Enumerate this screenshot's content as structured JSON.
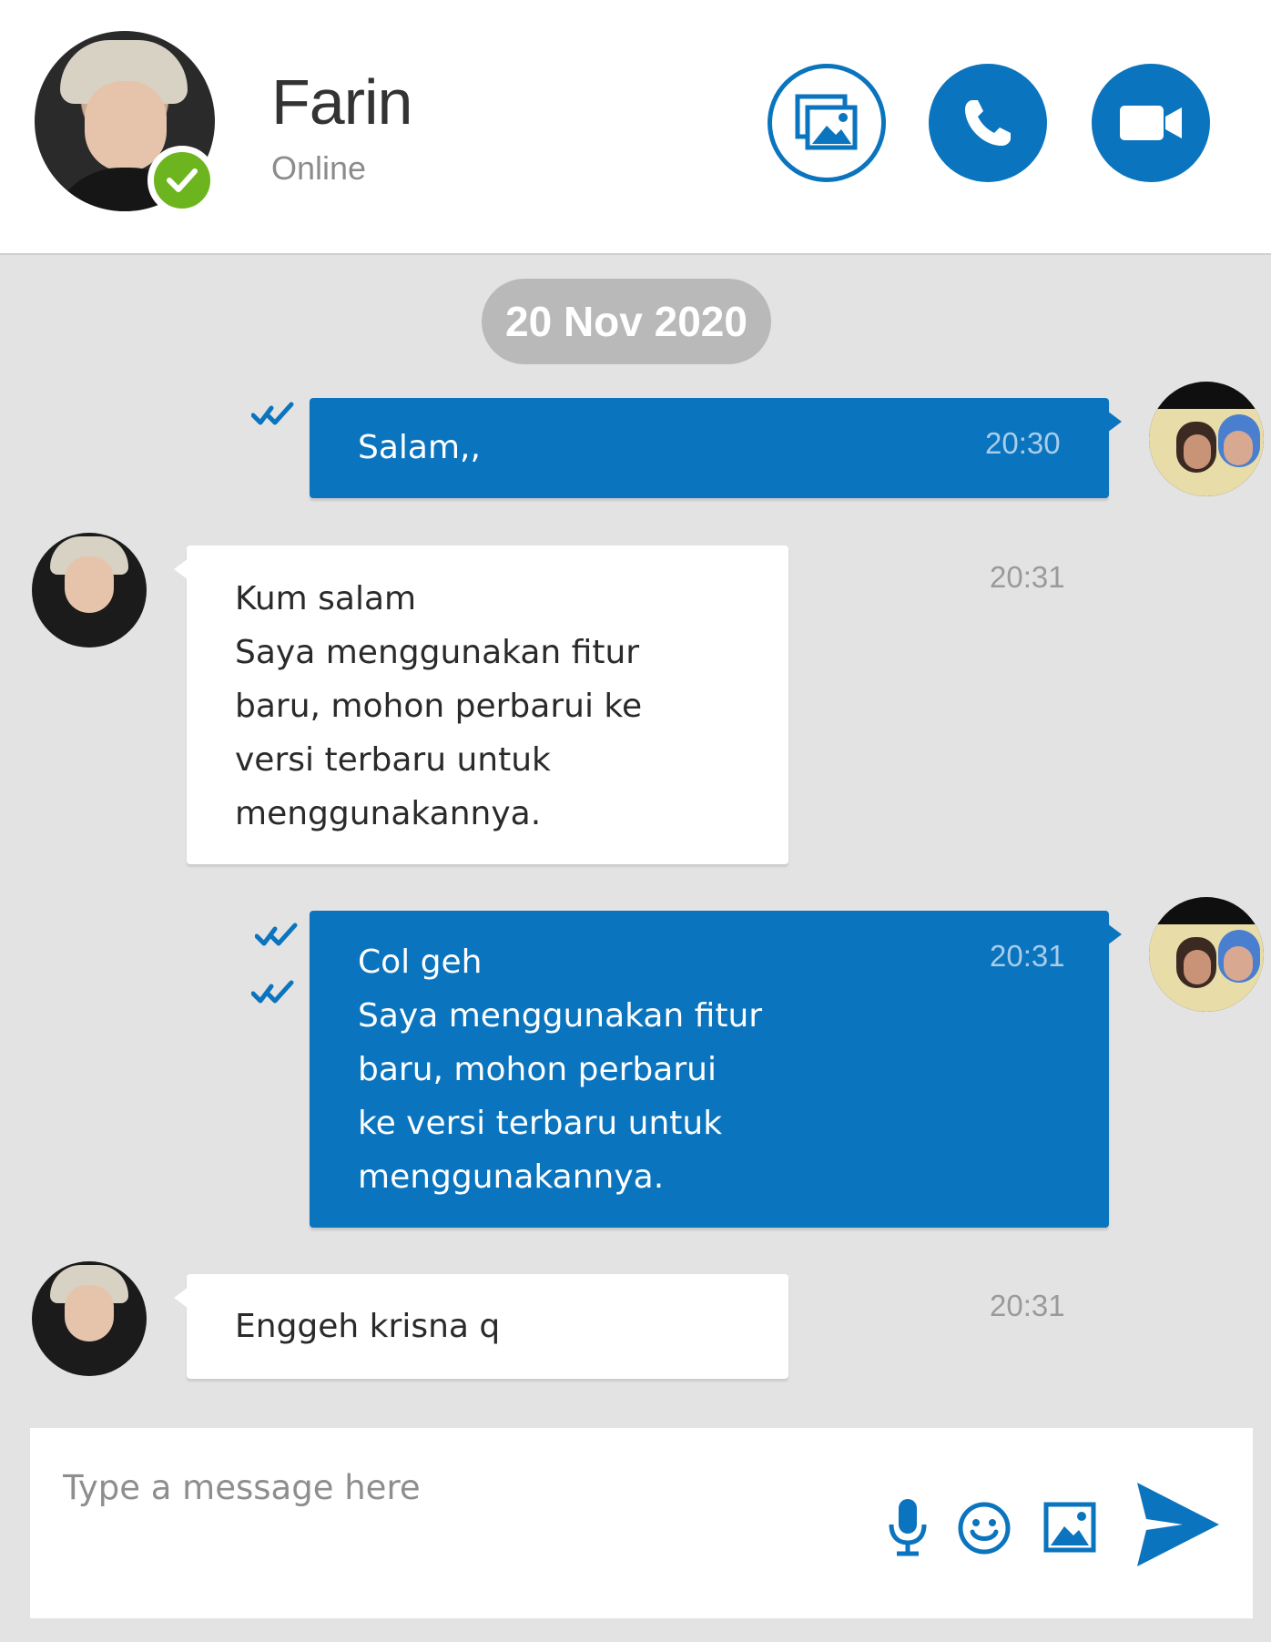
{
  "header": {
    "contact_name": "Farin",
    "contact_status": "Online",
    "buttons": {
      "gallery_icon": "gallery-icon",
      "call_icon": "phone-icon",
      "video_icon": "video-camera-icon"
    }
  },
  "conversation": {
    "date_divider": "20 Nov 2020",
    "messages": [
      {
        "direction": "outgoing",
        "text": "Salam,,",
        "time": "20:30",
        "status": "read"
      },
      {
        "direction": "incoming",
        "text": "Kum salam\nSaya menggunakan fitur\nbaru, mohon perbarui ke\nversi terbaru untuk\nmenggunakannya.",
        "time": "20:31"
      },
      {
        "direction": "outgoing",
        "text": "Col geh\nSaya menggunakan fitur\nbaru, mohon perbarui\nke versi terbaru untuk\nmenggunakannya.",
        "time": "20:31",
        "status": "read"
      },
      {
        "direction": "incoming",
        "text": "Enggeh krisna q",
        "time": "20:31"
      }
    ]
  },
  "composer": {
    "placeholder": "Type a message here",
    "value": "",
    "icons": [
      "microphone-icon",
      "emoji-icon",
      "image-icon",
      "send-icon"
    ]
  },
  "colors": {
    "accent": "#0a74be",
    "online": "#6cb51f",
    "chat_background": "#e3e3e3",
    "incoming_bubble": "#ffffff",
    "date_pill": "#b9b9b9"
  }
}
